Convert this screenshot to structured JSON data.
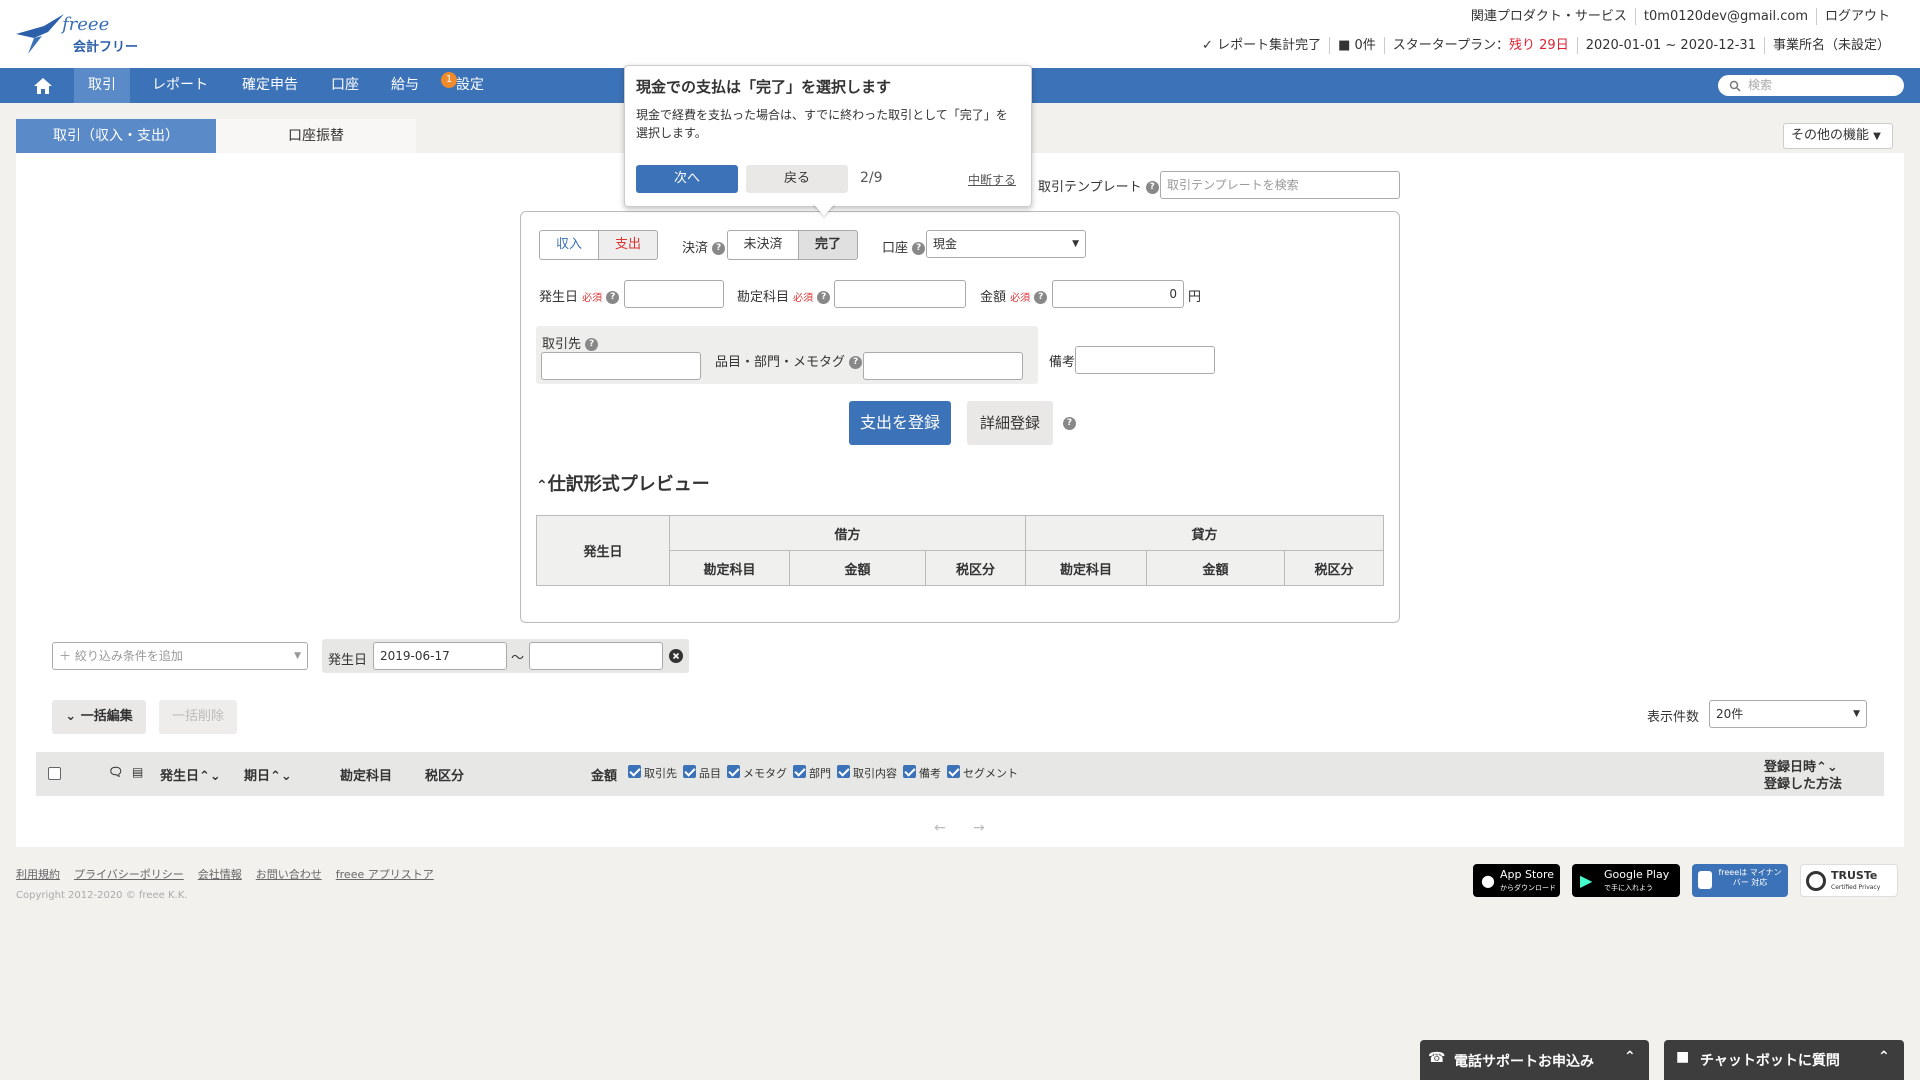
{
  "header": {
    "logo_text": "freee",
    "logo_subtext": "会計フリー",
    "links": [
      "関連プロダクト・サービス",
      "t0m0120dev@gmail.com",
      "ログアウト"
    ],
    "status": {
      "report": "レポート集計完了",
      "messages": "0件",
      "plan_label": "スタータープラン：",
      "plan_remaining": "残り 29日",
      "period": "2020-01-01 ~ 2020-12-31",
      "office": "事業所名（未設定）"
    }
  },
  "nav": {
    "items": [
      "取引",
      "レポート",
      "確定申告",
      "口座",
      "給与",
      "設定"
    ],
    "badge": "1",
    "search_placeholder": "検索"
  },
  "subtabs": {
    "tabs": [
      "取引（収入・支出）",
      "口座振替"
    ],
    "other": "その他の機能"
  },
  "tooltip": {
    "title": "現金での支払は「完了」を選択します",
    "body": "現金で経費を支払った場合は、すでに終わった取引として「完了」を選択します。",
    "next": "次へ",
    "back": "戻る",
    "progress": "2/9",
    "abort": "中断する"
  },
  "template": {
    "label": "取引テンプレート",
    "placeholder": "取引テンプレートを検索"
  },
  "form": {
    "income": "収入",
    "expense": "支出",
    "settlement_label": "決済",
    "unsettled": "未決済",
    "settled": "完了",
    "account_label": "口座",
    "account_value": "現金",
    "date_label": "発生日",
    "required": "必須",
    "item_label": "勘定科目",
    "amount_label": "金額",
    "amount_value": "0",
    "yen": "円",
    "partner_label": "取引先",
    "tags_label": "品目・部門・メモタグ",
    "note_label": "備考",
    "register_btn": "支出を登録",
    "detail_btn": "詳細登録"
  },
  "preview": {
    "title": "仕訳形式プレビュー",
    "date": "発生日",
    "debit": "借方",
    "credit": "貸方",
    "cols": [
      "勘定科目",
      "金額",
      "税区分",
      "勘定科目",
      "金額",
      "税区分"
    ]
  },
  "filter": {
    "add_placeholder": "＋ 絞り込み条件を追加",
    "date_label": "発生日",
    "date_from": "2019-06-17",
    "tilde": "〜"
  },
  "list": {
    "bulk_edit": "一括編集",
    "bulk_delete": "一括削除",
    "per_page_label": "表示件数",
    "per_page_value": "20件",
    "cols": {
      "date": "発生日",
      "due": "期日",
      "item": "勘定科目",
      "tax": "税区分",
      "amount": "金額",
      "registered": "登録日時",
      "method": "登録した方法"
    },
    "toggles": [
      "取引先",
      "品目",
      "メモタグ",
      "部門",
      "取引内容",
      "備考",
      "セグメント"
    ]
  },
  "footer": {
    "links": [
      "利用規約",
      "プライバシーポリシー",
      "会社情報",
      "お問い合わせ",
      "freee アプリストア"
    ],
    "copyright": "Copyright 2012-2020 © freee K.K.",
    "appstore_top": "App Store",
    "appstore_sub": "からダウンロード",
    "googleplay_top": "Google Play",
    "googleplay_sub": "で手に入れよう",
    "mynumber": "freeeは マイナンバー 対応",
    "truste": "TRUSTe",
    "truste_sub": "Certified Privacy"
  },
  "bottom": {
    "phone": "電話サポートお申込み",
    "chat": "チャットボットに質問"
  }
}
